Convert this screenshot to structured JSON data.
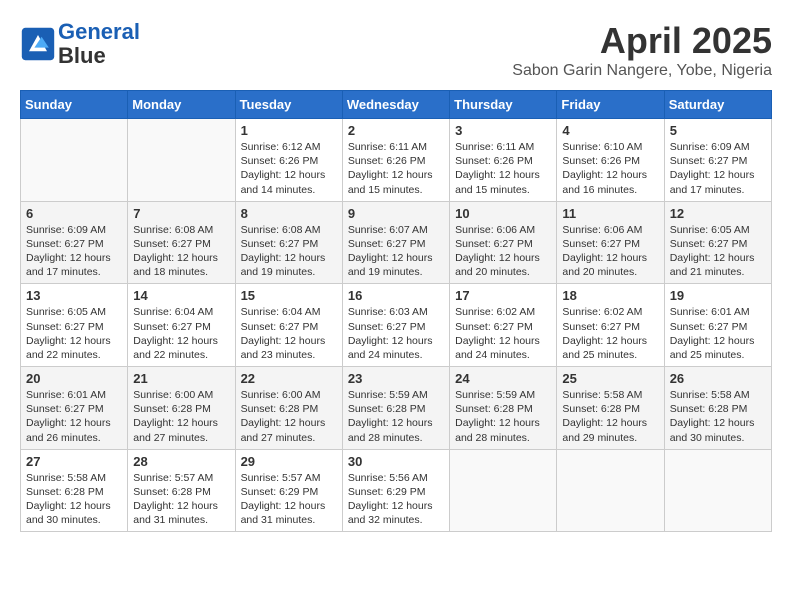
{
  "header": {
    "logo_line1": "General",
    "logo_line2": "Blue",
    "month": "April 2025",
    "location": "Sabon Garin Nangere, Yobe, Nigeria"
  },
  "days_of_week": [
    "Sunday",
    "Monday",
    "Tuesday",
    "Wednesday",
    "Thursday",
    "Friday",
    "Saturday"
  ],
  "weeks": [
    [
      {
        "day": "",
        "sunrise": "",
        "sunset": "",
        "daylight": ""
      },
      {
        "day": "",
        "sunrise": "",
        "sunset": "",
        "daylight": ""
      },
      {
        "day": "1",
        "sunrise": "Sunrise: 6:12 AM",
        "sunset": "Sunset: 6:26 PM",
        "daylight": "Daylight: 12 hours and 14 minutes."
      },
      {
        "day": "2",
        "sunrise": "Sunrise: 6:11 AM",
        "sunset": "Sunset: 6:26 PM",
        "daylight": "Daylight: 12 hours and 15 minutes."
      },
      {
        "day": "3",
        "sunrise": "Sunrise: 6:11 AM",
        "sunset": "Sunset: 6:26 PM",
        "daylight": "Daylight: 12 hours and 15 minutes."
      },
      {
        "day": "4",
        "sunrise": "Sunrise: 6:10 AM",
        "sunset": "Sunset: 6:26 PM",
        "daylight": "Daylight: 12 hours and 16 minutes."
      },
      {
        "day": "5",
        "sunrise": "Sunrise: 6:09 AM",
        "sunset": "Sunset: 6:27 PM",
        "daylight": "Daylight: 12 hours and 17 minutes."
      }
    ],
    [
      {
        "day": "6",
        "sunrise": "Sunrise: 6:09 AM",
        "sunset": "Sunset: 6:27 PM",
        "daylight": "Daylight: 12 hours and 17 minutes."
      },
      {
        "day": "7",
        "sunrise": "Sunrise: 6:08 AM",
        "sunset": "Sunset: 6:27 PM",
        "daylight": "Daylight: 12 hours and 18 minutes."
      },
      {
        "day": "8",
        "sunrise": "Sunrise: 6:08 AM",
        "sunset": "Sunset: 6:27 PM",
        "daylight": "Daylight: 12 hours and 19 minutes."
      },
      {
        "day": "9",
        "sunrise": "Sunrise: 6:07 AM",
        "sunset": "Sunset: 6:27 PM",
        "daylight": "Daylight: 12 hours and 19 minutes."
      },
      {
        "day": "10",
        "sunrise": "Sunrise: 6:06 AM",
        "sunset": "Sunset: 6:27 PM",
        "daylight": "Daylight: 12 hours and 20 minutes."
      },
      {
        "day": "11",
        "sunrise": "Sunrise: 6:06 AM",
        "sunset": "Sunset: 6:27 PM",
        "daylight": "Daylight: 12 hours and 20 minutes."
      },
      {
        "day": "12",
        "sunrise": "Sunrise: 6:05 AM",
        "sunset": "Sunset: 6:27 PM",
        "daylight": "Daylight: 12 hours and 21 minutes."
      }
    ],
    [
      {
        "day": "13",
        "sunrise": "Sunrise: 6:05 AM",
        "sunset": "Sunset: 6:27 PM",
        "daylight": "Daylight: 12 hours and 22 minutes."
      },
      {
        "day": "14",
        "sunrise": "Sunrise: 6:04 AM",
        "sunset": "Sunset: 6:27 PM",
        "daylight": "Daylight: 12 hours and 22 minutes."
      },
      {
        "day": "15",
        "sunrise": "Sunrise: 6:04 AM",
        "sunset": "Sunset: 6:27 PM",
        "daylight": "Daylight: 12 hours and 23 minutes."
      },
      {
        "day": "16",
        "sunrise": "Sunrise: 6:03 AM",
        "sunset": "Sunset: 6:27 PM",
        "daylight": "Daylight: 12 hours and 24 minutes."
      },
      {
        "day": "17",
        "sunrise": "Sunrise: 6:02 AM",
        "sunset": "Sunset: 6:27 PM",
        "daylight": "Daylight: 12 hours and 24 minutes."
      },
      {
        "day": "18",
        "sunrise": "Sunrise: 6:02 AM",
        "sunset": "Sunset: 6:27 PM",
        "daylight": "Daylight: 12 hours and 25 minutes."
      },
      {
        "day": "19",
        "sunrise": "Sunrise: 6:01 AM",
        "sunset": "Sunset: 6:27 PM",
        "daylight": "Daylight: 12 hours and 25 minutes."
      }
    ],
    [
      {
        "day": "20",
        "sunrise": "Sunrise: 6:01 AM",
        "sunset": "Sunset: 6:27 PM",
        "daylight": "Daylight: 12 hours and 26 minutes."
      },
      {
        "day": "21",
        "sunrise": "Sunrise: 6:00 AM",
        "sunset": "Sunset: 6:28 PM",
        "daylight": "Daylight: 12 hours and 27 minutes."
      },
      {
        "day": "22",
        "sunrise": "Sunrise: 6:00 AM",
        "sunset": "Sunset: 6:28 PM",
        "daylight": "Daylight: 12 hours and 27 minutes."
      },
      {
        "day": "23",
        "sunrise": "Sunrise: 5:59 AM",
        "sunset": "Sunset: 6:28 PM",
        "daylight": "Daylight: 12 hours and 28 minutes."
      },
      {
        "day": "24",
        "sunrise": "Sunrise: 5:59 AM",
        "sunset": "Sunset: 6:28 PM",
        "daylight": "Daylight: 12 hours and 28 minutes."
      },
      {
        "day": "25",
        "sunrise": "Sunrise: 5:58 AM",
        "sunset": "Sunset: 6:28 PM",
        "daylight": "Daylight: 12 hours and 29 minutes."
      },
      {
        "day": "26",
        "sunrise": "Sunrise: 5:58 AM",
        "sunset": "Sunset: 6:28 PM",
        "daylight": "Daylight: 12 hours and 30 minutes."
      }
    ],
    [
      {
        "day": "27",
        "sunrise": "Sunrise: 5:58 AM",
        "sunset": "Sunset: 6:28 PM",
        "daylight": "Daylight: 12 hours and 30 minutes."
      },
      {
        "day": "28",
        "sunrise": "Sunrise: 5:57 AM",
        "sunset": "Sunset: 6:28 PM",
        "daylight": "Daylight: 12 hours and 31 minutes."
      },
      {
        "day": "29",
        "sunrise": "Sunrise: 5:57 AM",
        "sunset": "Sunset: 6:29 PM",
        "daylight": "Daylight: 12 hours and 31 minutes."
      },
      {
        "day": "30",
        "sunrise": "Sunrise: 5:56 AM",
        "sunset": "Sunset: 6:29 PM",
        "daylight": "Daylight: 12 hours and 32 minutes."
      },
      {
        "day": "",
        "sunrise": "",
        "sunset": "",
        "daylight": ""
      },
      {
        "day": "",
        "sunrise": "",
        "sunset": "",
        "daylight": ""
      },
      {
        "day": "",
        "sunrise": "",
        "sunset": "",
        "daylight": ""
      }
    ]
  ]
}
